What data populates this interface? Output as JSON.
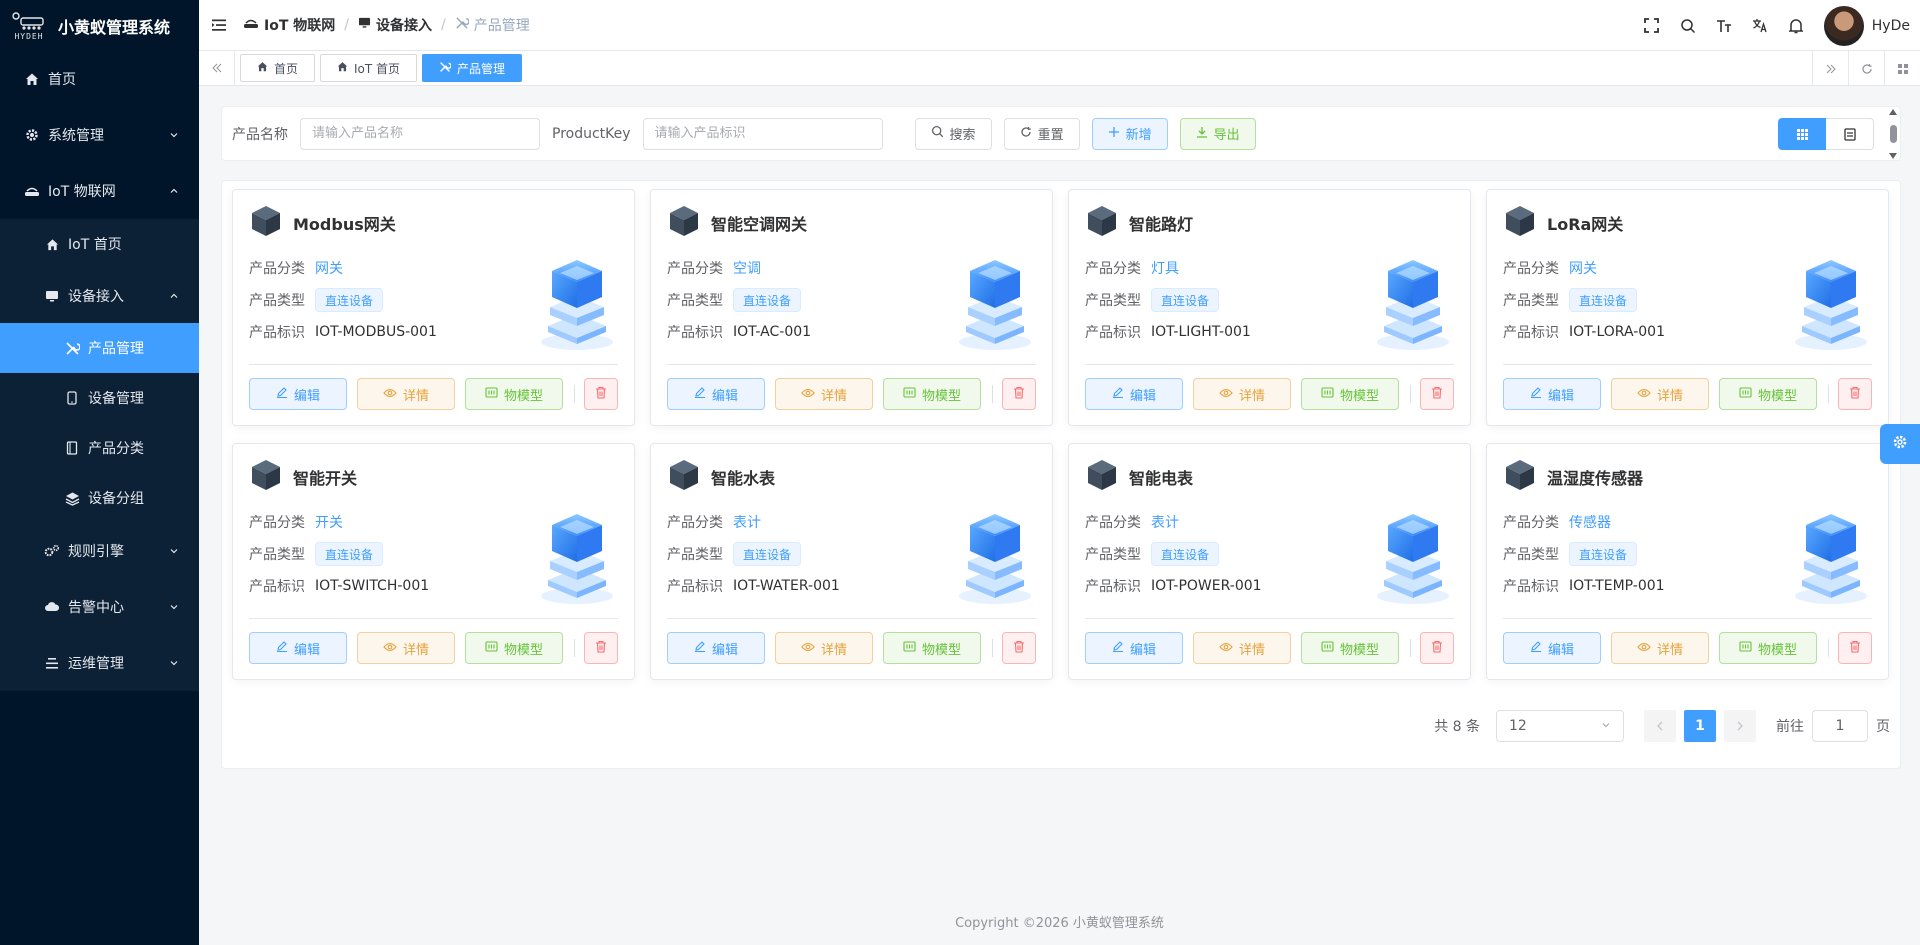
{
  "app": {
    "logo_text": "HYDEH",
    "title": "小黄蚁管理系统"
  },
  "sidebar": {
    "items": [
      {
        "label": "首页",
        "icon": "home-icon"
      },
      {
        "label": "系统管理",
        "icon": "gear-icon"
      },
      {
        "label": "IoT 物联网",
        "icon": "router-icon"
      },
      {
        "label": "IoT 首页",
        "icon": "home-icon"
      },
      {
        "label": "设备接入",
        "icon": "monitor-icon"
      },
      {
        "label": "产品管理",
        "icon": "tools-icon"
      },
      {
        "label": "设备管理",
        "icon": "phone-icon"
      },
      {
        "label": "产品分类",
        "icon": "book-icon"
      },
      {
        "label": "设备分组",
        "icon": "layers-icon"
      },
      {
        "label": "规则引擎",
        "icon": "cogs-icon"
      },
      {
        "label": "告警中心",
        "icon": "cloud-icon"
      },
      {
        "label": "运维管理",
        "icon": "list-icon"
      }
    ]
  },
  "header": {
    "breadcrumb": [
      "IoT 物联网",
      "设备接入",
      "产品管理"
    ],
    "username": "HyDe"
  },
  "tabs": [
    {
      "label": "首页"
    },
    {
      "label": "IoT 首页"
    },
    {
      "label": "产品管理",
      "active": true
    }
  ],
  "search": {
    "name_label": "产品名称",
    "name_placeholder": "请输入产品名称",
    "key_label": "ProductKey",
    "key_placeholder": "请输入产品标识",
    "search_btn": "搜索",
    "reset_btn": "重置",
    "add_btn": "新增",
    "export_btn": "导出"
  },
  "card_labels": {
    "category": "产品分类",
    "type": "产品类型",
    "key": "产品标识",
    "edit": "编辑",
    "detail": "详情",
    "model": "物模型"
  },
  "products": [
    {
      "name": "Modbus网关",
      "category": "网关",
      "type": "直连设备",
      "key": "IOT-MODBUS-001"
    },
    {
      "name": "智能空调网关",
      "category": "空调",
      "type": "直连设备",
      "key": "IOT-AC-001"
    },
    {
      "name": "智能路灯",
      "category": "灯具",
      "type": "直连设备",
      "key": "IOT-LIGHT-001"
    },
    {
      "name": "LoRa网关",
      "category": "网关",
      "type": "直连设备",
      "key": "IOT-LORA-001"
    },
    {
      "name": "智能开关",
      "category": "开关",
      "type": "直连设备",
      "key": "IOT-SWITCH-001"
    },
    {
      "name": "智能水表",
      "category": "表计",
      "type": "直连设备",
      "key": "IOT-WATER-001"
    },
    {
      "name": "智能电表",
      "category": "表计",
      "type": "直连设备",
      "key": "IOT-POWER-001"
    },
    {
      "name": "温湿度传感器",
      "category": "传感器",
      "type": "直连设备",
      "key": "IOT-TEMP-001"
    }
  ],
  "pagination": {
    "total_text": "共 8 条",
    "page_size": "12",
    "current_page": "1",
    "goto_label": "前往",
    "goto_value": "1",
    "page_suffix": "页"
  },
  "footer": {
    "copyright": "Copyright ©2026 小黄蚁管理系统"
  },
  "colors": {
    "sidebar_bg": "#001529",
    "primary": "#409eff",
    "success": "#67c23a",
    "warning": "#e6a23c",
    "danger": "#f56c6c"
  }
}
